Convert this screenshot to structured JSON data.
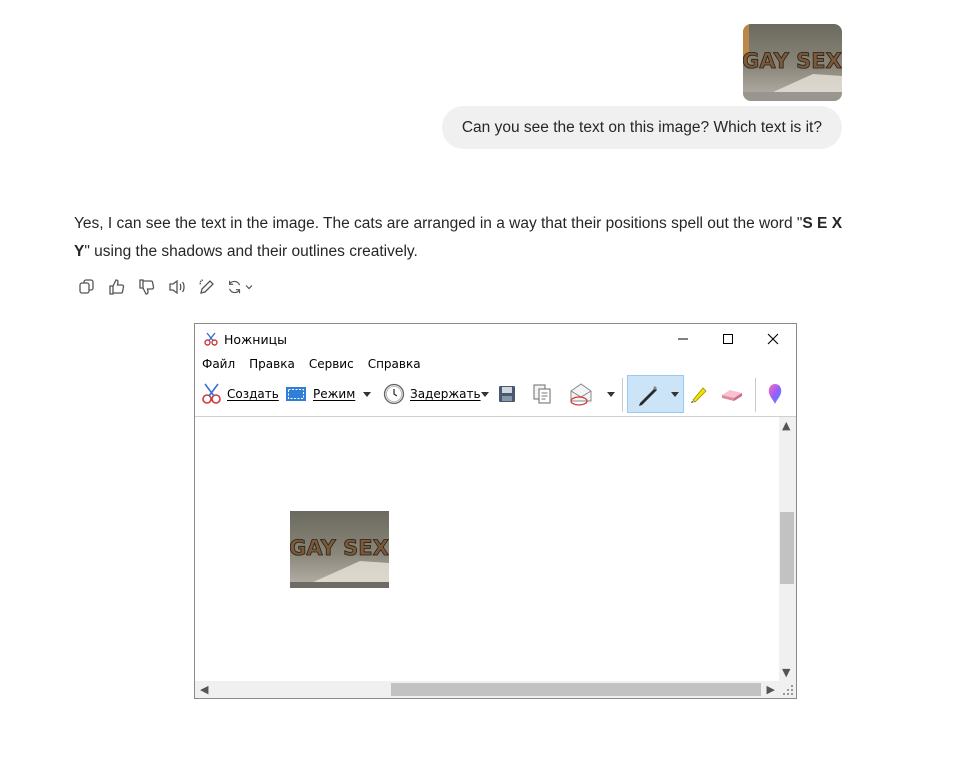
{
  "chat": {
    "user_image_alt": "image of cats",
    "user_image_text": "GAY SEX",
    "user_message": "Can you see the text on this image? Which text is it?",
    "answer_before": "Yes, I can see the text in the image. The cats are arranged in a way that their positions spell out the word \"",
    "answer_bold": "S E X Y",
    "answer_after": "\" using the shadows and their outlines creatively.",
    "actions": [
      "copy-icon",
      "thumbs-up-icon",
      "thumbs-down-icon",
      "read-aloud-icon",
      "edit-icon",
      "regenerate-icon"
    ]
  },
  "snip": {
    "title": "Ножницы",
    "menu": [
      "Файл",
      "Правка",
      "Сервис",
      "Справка"
    ],
    "toolbar": {
      "create": "Создать",
      "mode": "Режим",
      "delay": "Задержать"
    },
    "captured_text": "GAY SEX"
  },
  "colors": {
    "bubble": "#f0f0f0",
    "pen_active": "#cce4f7",
    "scrollbar": "#c2c2c2"
  }
}
